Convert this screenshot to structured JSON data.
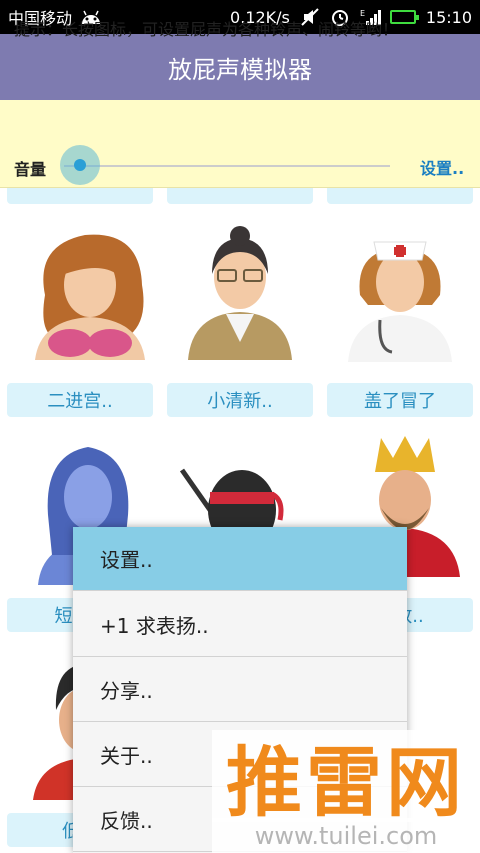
{
  "status_bar": {
    "carrier": "中国移动",
    "speed": "0.12K/s",
    "signal_type": "E",
    "time": "15:10"
  },
  "app": {
    "title": "放屁声模拟器"
  },
  "hint_panel": {
    "text": "提示：长按图标，可设置屁声为各种铃声、闹铃等哟！",
    "volume_label": "音量",
    "volume_level": 0.05,
    "settings_link": "设置.."
  },
  "grid": {
    "row2": [
      "二进宫..",
      "小清新..",
      "盖了冒了"
    ],
    "row3": [
      "短+平",
      "",
      "补放.."
    ],
    "row4": [
      "低调"
    ]
  },
  "context_menu": {
    "items": [
      "设置..",
      "+1 求表扬..",
      "分享..",
      "关于..",
      "反馈.."
    ]
  },
  "watermark": {
    "name": "推雷网",
    "url": "www.tuilei.com"
  },
  "colors": {
    "title_bar": "#7e7bb0",
    "hint_bg": "#fffcc8",
    "label_bg": "#dbf3fb",
    "label_text": "#2a8fc0",
    "menu_highlight": "#87cde6",
    "watermark": "#f08a1c"
  }
}
